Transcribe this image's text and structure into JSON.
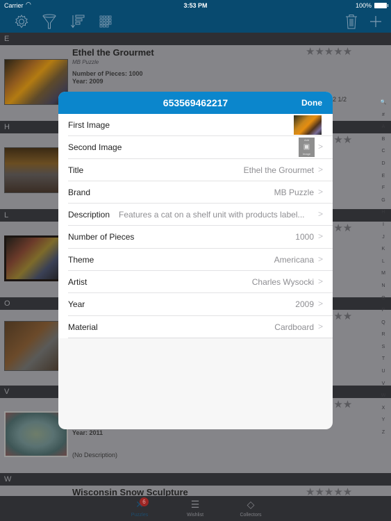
{
  "status_bar": {
    "carrier": "Carrier",
    "time": "3:53 PM",
    "battery": "100%"
  },
  "toolbar": {
    "icons": [
      "gear-icon",
      "filter-icon",
      "sort-icon",
      "grid-icon",
      "trash-icon",
      "plus-icon"
    ]
  },
  "list": {
    "sections": [
      {
        "letter": "E"
      },
      {
        "letter": "H"
      },
      {
        "letter": "L"
      },
      {
        "letter": "O"
      },
      {
        "letter": "V"
      },
      {
        "letter": "W"
      }
    ],
    "items": [
      {
        "title": "Ethel the Grourmet",
        "brand": "MB Puzzle",
        "pieces": "Number of Pieces: 1000",
        "year": "Year: 2009",
        "extra": "2 1/2"
      },
      {
        "year": "Year: 2011",
        "description": "(No Description)"
      },
      {
        "title": "Wisconsin Snow Sculpture"
      }
    ],
    "alpha_index": [
      "🔍",
      "#",
      "A",
      "B",
      "C",
      "D",
      "E",
      "F",
      "G",
      "H",
      "I",
      "J",
      "K",
      "L",
      "M",
      "N",
      "O",
      "P",
      "Q",
      "R",
      "S",
      "T",
      "U",
      "V",
      "W",
      "X",
      "Y",
      "Z"
    ]
  },
  "modal": {
    "title": "653569462217",
    "done_label": "Done",
    "rows": [
      {
        "label": "First Image",
        "value": ""
      },
      {
        "label": "Second Image",
        "value": "",
        "add_top": "Add",
        "add_bottom": "Image"
      },
      {
        "label": "Title",
        "value": "Ethel the Grourmet"
      },
      {
        "label": "Brand",
        "value": "MB Puzzle"
      },
      {
        "label": "Description",
        "value": "Features a cat on a shelf unit with products label..."
      },
      {
        "label": "Number of Pieces",
        "value": "1000"
      },
      {
        "label": "Theme",
        "value": "Americana"
      },
      {
        "label": "Artist",
        "value": "Charles Wysocki"
      },
      {
        "label": "Year",
        "value": "2009"
      },
      {
        "label": "Material",
        "value": "Cardboard"
      }
    ]
  },
  "tabbar": {
    "tabs": [
      {
        "label": "Puzzles",
        "badge": "6",
        "active": true
      },
      {
        "label": "Wishlist"
      },
      {
        "label": "Collectors"
      }
    ]
  }
}
